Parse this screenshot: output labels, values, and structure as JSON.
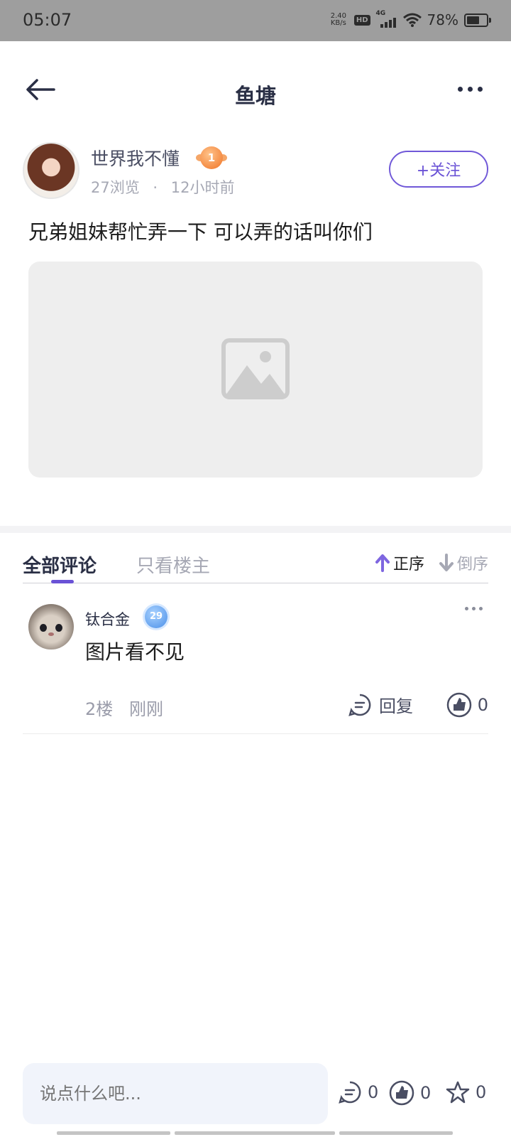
{
  "status_bar": {
    "time": "05:07",
    "net_speed_value": "2.40",
    "net_speed_unit": "KB/s",
    "hd_label": "HD",
    "network_type": "4G",
    "battery_percent": "78%",
    "battery_level": 0.78,
    "icons": [
      "hd-icon",
      "signal-icon",
      "wifi-icon",
      "battery-icon"
    ]
  },
  "header": {
    "title": "鱼塘",
    "back_icon": "arrow-left-icon",
    "more_icon": "more-dots-icon"
  },
  "post": {
    "author": {
      "name": "世界我不懂",
      "level": "1",
      "views": "27浏览",
      "separator": "·",
      "time": "12小时前"
    },
    "follow_label": "+关注",
    "content": "兄弟姐妹帮忙弄一下 可以弄的话叫你们",
    "image_icon": "image-placeholder-icon"
  },
  "comments_section": {
    "tabs": [
      {
        "label": "全部评论",
        "active": true
      },
      {
        "label": "只看楼主",
        "active": false
      }
    ],
    "sort_asc_label": "正序",
    "sort_desc_label": "倒序",
    "comments": [
      {
        "user": "钛合金",
        "level": "29",
        "text": "图片看不见",
        "floor": "2楼",
        "time": "刚刚",
        "reply_label": "回复",
        "likes": "0"
      }
    ]
  },
  "bottom_bar": {
    "input_placeholder": "说点什么吧...",
    "comment_count": "0",
    "like_count": "0",
    "favorite_count": "0"
  },
  "colors": {
    "accent": "#6a52d6",
    "text_primary": "#1c1c1c",
    "text_secondary": "#a6a8b4",
    "status_bar": "#9e9e9e"
  }
}
